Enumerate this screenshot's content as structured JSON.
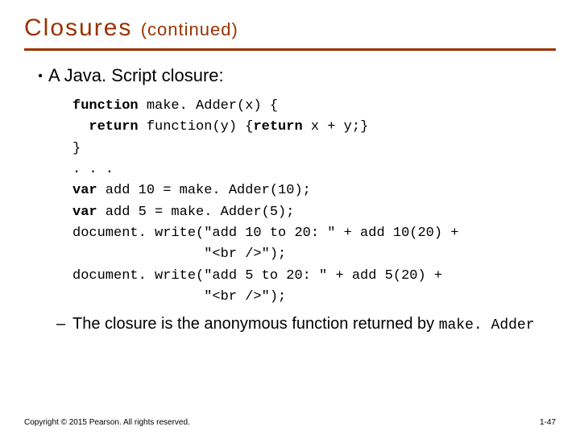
{
  "title_main": "Closures ",
  "title_sub": "(continued)",
  "bullet1_text": "A Java. Script closure:",
  "code_lines": [
    {
      "segments": [
        {
          "t": "function",
          "b": true
        },
        {
          "t": " make. Adder(x) {",
          "b": false
        }
      ]
    },
    {
      "segments": [
        {
          "t": "  ",
          "b": false
        },
        {
          "t": "return",
          "b": true
        },
        {
          "t": " function(y) {",
          "b": false
        },
        {
          "t": "return",
          "b": true
        },
        {
          "t": " x + y;}",
          "b": false
        }
      ]
    },
    {
      "segments": [
        {
          "t": "}",
          "b": false
        }
      ]
    },
    {
      "segments": [
        {
          "t": ". . .",
          "b": false
        }
      ]
    },
    {
      "segments": [
        {
          "t": "var",
          "b": true
        },
        {
          "t": " add 10 = make. Adder(10);",
          "b": false
        }
      ]
    },
    {
      "segments": [
        {
          "t": "var",
          "b": true
        },
        {
          "t": " add 5 = make. Adder(5);",
          "b": false
        }
      ]
    },
    {
      "segments": [
        {
          "t": "document. write(\"add 10 to 20: \" + add 10(20) +",
          "b": false
        }
      ]
    },
    {
      "segments": [
        {
          "t": "                \"<br />\");",
          "b": false
        }
      ]
    },
    {
      "segments": [
        {
          "t": "document. write(\"add 5 to 20: \" + add 5(20) +",
          "b": false
        }
      ]
    },
    {
      "segments": [
        {
          "t": "                \"<br />\");",
          "b": false
        }
      ]
    }
  ],
  "bullet2_pre": "The closure is the anonymous function returned by ",
  "bullet2_mono": "make. Adder",
  "footer_left": "Copyright © 2015 Pearson. All rights reserved.",
  "footer_right": "1-47"
}
